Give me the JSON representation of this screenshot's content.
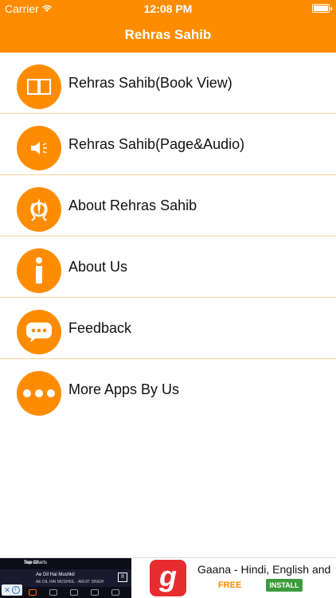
{
  "status_bar": {
    "carrier": "Carrier",
    "time": "12:08 PM"
  },
  "header": {
    "title": "Rehras Sahib"
  },
  "menu": {
    "items": [
      {
        "label": "Rehras Sahib(Book View)",
        "icon": "book-icon"
      },
      {
        "label": "Rehras Sahib(Page&Audio)",
        "icon": "speaker-icon"
      },
      {
        "label": "About Rehras Sahib",
        "icon": "khanda-icon"
      },
      {
        "label": "About Us",
        "icon": "info-icon"
      },
      {
        "label": "Feedback",
        "icon": "chat-bubble-icon"
      },
      {
        "label": "More Apps By Us",
        "icon": "more-dots-icon"
      }
    ]
  },
  "ad": {
    "thumb_header": "Top Charts",
    "thumb_see_all": "See All",
    "thumb_song": "Ae Dil Hai Mushkil",
    "thumb_artist": "AE DIL HAI MUSHKIL · ARIJIT SINGH",
    "app_title": "Gaana - Hindi, English and ...",
    "price": "FREE",
    "install_label": "INSTALL",
    "logo_letter": "g"
  },
  "colors": {
    "accent": "#FF8C00",
    "divider": "#f6d19a",
    "install_green": "#3d9b3d",
    "gaana_red": "#e72c30"
  }
}
